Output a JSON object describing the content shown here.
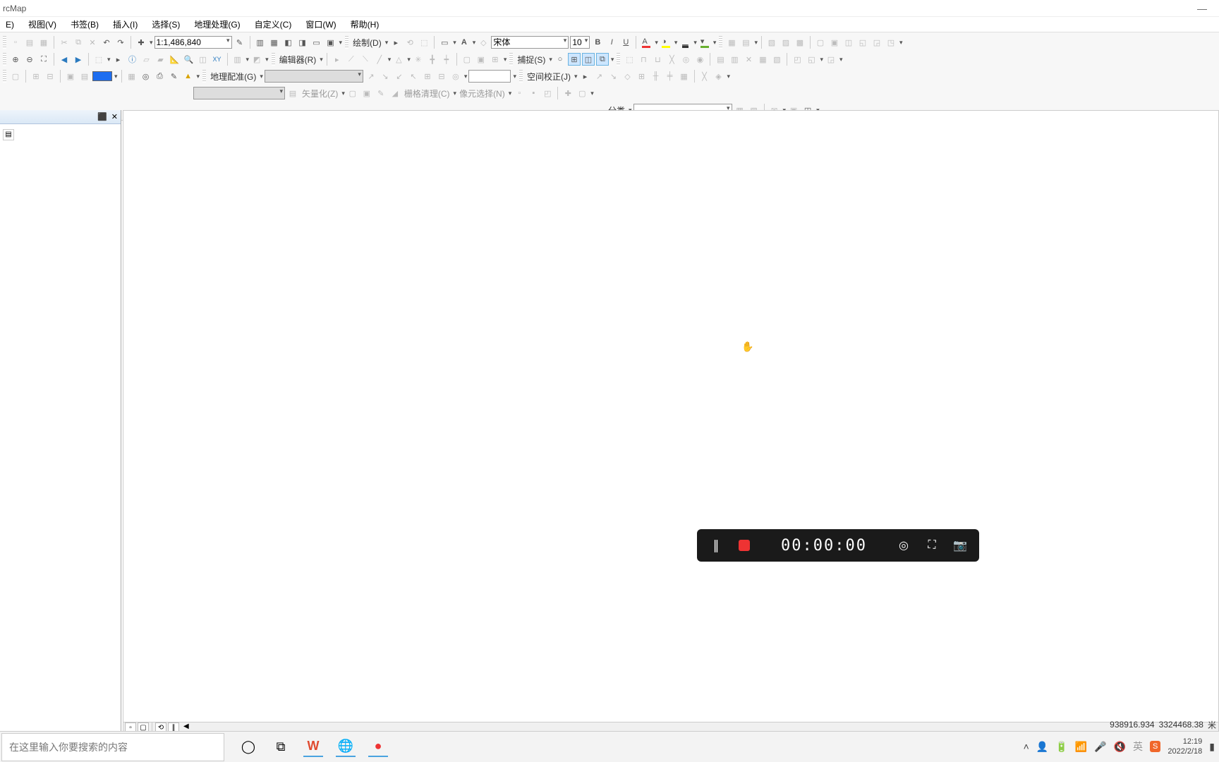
{
  "window": {
    "title": "rcMap",
    "minimize": "—"
  },
  "menu": {
    "file": "E)",
    "view": "视图(V)",
    "bookmark": "书签(B)",
    "insert": "插入(I)",
    "select": "选择(S)",
    "geoprocess": "地理处理(G)",
    "customize": "自定义(C)",
    "window": "窗口(W)",
    "help": "帮助(H)"
  },
  "toolbar": {
    "scale": "1:1,486,840",
    "draw_label": "绘制(D)",
    "font_name": "宋体",
    "font_size": "10",
    "editor_label": "编辑器(R)",
    "snap_label": "捕捉(S)",
    "georef_label": "地理配准(G)",
    "spatial_adj_label": "空间校正(J)",
    "vectorize_label": "矢量化(Z)",
    "raster_cleanup_label": "栅格清理(C)",
    "cell_select_label": "像元选择(N)",
    "classify_label": "分类",
    "text_input": "",
    "georef_combo": "",
    "spatial_input": "",
    "vector_combo": "",
    "classify_combo": "",
    "blue_swatch": "#1e6ef0"
  },
  "status": {
    "coord_x": "938916.934",
    "coord_y": "3324468.38",
    "unit": "米"
  },
  "recorder": {
    "time": "00:00:00"
  },
  "taskbar": {
    "search_placeholder": "在这里输入你要搜索的内容"
  },
  "tray": {
    "time": "12:19",
    "date": "2022/2/18"
  }
}
